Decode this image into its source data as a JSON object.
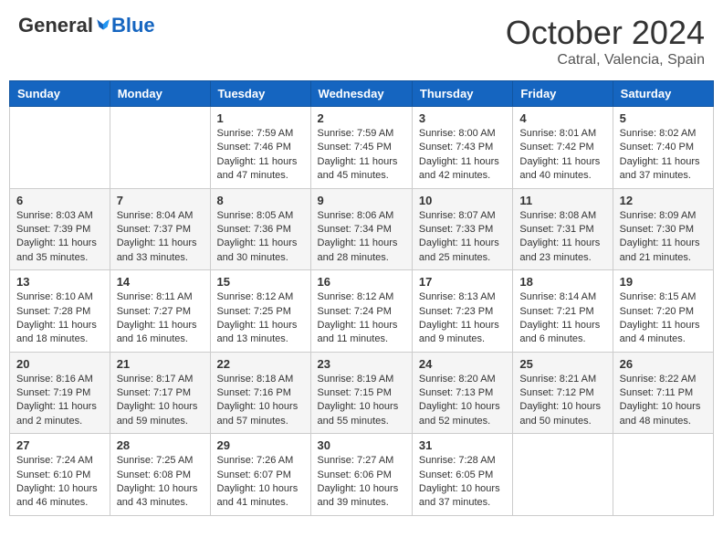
{
  "header": {
    "logo_general": "General",
    "logo_blue": "Blue",
    "month": "October 2024",
    "location": "Catral, Valencia, Spain"
  },
  "weekdays": [
    "Sunday",
    "Monday",
    "Tuesday",
    "Wednesday",
    "Thursday",
    "Friday",
    "Saturday"
  ],
  "weeks": [
    [
      {
        "day": "",
        "info": ""
      },
      {
        "day": "",
        "info": ""
      },
      {
        "day": "1",
        "info": "Sunrise: 7:59 AM\nSunset: 7:46 PM\nDaylight: 11 hours and 47 minutes."
      },
      {
        "day": "2",
        "info": "Sunrise: 7:59 AM\nSunset: 7:45 PM\nDaylight: 11 hours and 45 minutes."
      },
      {
        "day": "3",
        "info": "Sunrise: 8:00 AM\nSunset: 7:43 PM\nDaylight: 11 hours and 42 minutes."
      },
      {
        "day": "4",
        "info": "Sunrise: 8:01 AM\nSunset: 7:42 PM\nDaylight: 11 hours and 40 minutes."
      },
      {
        "day": "5",
        "info": "Sunrise: 8:02 AM\nSunset: 7:40 PM\nDaylight: 11 hours and 37 minutes."
      }
    ],
    [
      {
        "day": "6",
        "info": "Sunrise: 8:03 AM\nSunset: 7:39 PM\nDaylight: 11 hours and 35 minutes."
      },
      {
        "day": "7",
        "info": "Sunrise: 8:04 AM\nSunset: 7:37 PM\nDaylight: 11 hours and 33 minutes."
      },
      {
        "day": "8",
        "info": "Sunrise: 8:05 AM\nSunset: 7:36 PM\nDaylight: 11 hours and 30 minutes."
      },
      {
        "day": "9",
        "info": "Sunrise: 8:06 AM\nSunset: 7:34 PM\nDaylight: 11 hours and 28 minutes."
      },
      {
        "day": "10",
        "info": "Sunrise: 8:07 AM\nSunset: 7:33 PM\nDaylight: 11 hours and 25 minutes."
      },
      {
        "day": "11",
        "info": "Sunrise: 8:08 AM\nSunset: 7:31 PM\nDaylight: 11 hours and 23 minutes."
      },
      {
        "day": "12",
        "info": "Sunrise: 8:09 AM\nSunset: 7:30 PM\nDaylight: 11 hours and 21 minutes."
      }
    ],
    [
      {
        "day": "13",
        "info": "Sunrise: 8:10 AM\nSunset: 7:28 PM\nDaylight: 11 hours and 18 minutes."
      },
      {
        "day": "14",
        "info": "Sunrise: 8:11 AM\nSunset: 7:27 PM\nDaylight: 11 hours and 16 minutes."
      },
      {
        "day": "15",
        "info": "Sunrise: 8:12 AM\nSunset: 7:25 PM\nDaylight: 11 hours and 13 minutes."
      },
      {
        "day": "16",
        "info": "Sunrise: 8:12 AM\nSunset: 7:24 PM\nDaylight: 11 hours and 11 minutes."
      },
      {
        "day": "17",
        "info": "Sunrise: 8:13 AM\nSunset: 7:23 PM\nDaylight: 11 hours and 9 minutes."
      },
      {
        "day": "18",
        "info": "Sunrise: 8:14 AM\nSunset: 7:21 PM\nDaylight: 11 hours and 6 minutes."
      },
      {
        "day": "19",
        "info": "Sunrise: 8:15 AM\nSunset: 7:20 PM\nDaylight: 11 hours and 4 minutes."
      }
    ],
    [
      {
        "day": "20",
        "info": "Sunrise: 8:16 AM\nSunset: 7:19 PM\nDaylight: 11 hours and 2 minutes."
      },
      {
        "day": "21",
        "info": "Sunrise: 8:17 AM\nSunset: 7:17 PM\nDaylight: 10 hours and 59 minutes."
      },
      {
        "day": "22",
        "info": "Sunrise: 8:18 AM\nSunset: 7:16 PM\nDaylight: 10 hours and 57 minutes."
      },
      {
        "day": "23",
        "info": "Sunrise: 8:19 AM\nSunset: 7:15 PM\nDaylight: 10 hours and 55 minutes."
      },
      {
        "day": "24",
        "info": "Sunrise: 8:20 AM\nSunset: 7:13 PM\nDaylight: 10 hours and 52 minutes."
      },
      {
        "day": "25",
        "info": "Sunrise: 8:21 AM\nSunset: 7:12 PM\nDaylight: 10 hours and 50 minutes."
      },
      {
        "day": "26",
        "info": "Sunrise: 8:22 AM\nSunset: 7:11 PM\nDaylight: 10 hours and 48 minutes."
      }
    ],
    [
      {
        "day": "27",
        "info": "Sunrise: 7:24 AM\nSunset: 6:10 PM\nDaylight: 10 hours and 46 minutes."
      },
      {
        "day": "28",
        "info": "Sunrise: 7:25 AM\nSunset: 6:08 PM\nDaylight: 10 hours and 43 minutes."
      },
      {
        "day": "29",
        "info": "Sunrise: 7:26 AM\nSunset: 6:07 PM\nDaylight: 10 hours and 41 minutes."
      },
      {
        "day": "30",
        "info": "Sunrise: 7:27 AM\nSunset: 6:06 PM\nDaylight: 10 hours and 39 minutes."
      },
      {
        "day": "31",
        "info": "Sunrise: 7:28 AM\nSunset: 6:05 PM\nDaylight: 10 hours and 37 minutes."
      },
      {
        "day": "",
        "info": ""
      },
      {
        "day": "",
        "info": ""
      }
    ]
  ]
}
